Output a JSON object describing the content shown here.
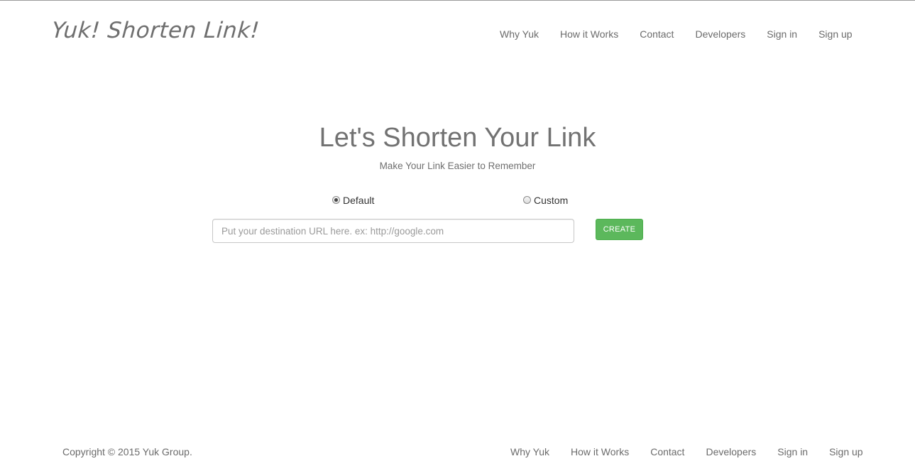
{
  "header": {
    "brand": "Yuk! Shorten Link!",
    "nav": [
      "Why Yuk",
      "How it Works",
      "Contact",
      "Developers",
      "Sign in",
      "Sign up"
    ]
  },
  "hero": {
    "title": "Let's Shorten Your Link",
    "subtitle": "Make Your Link Easier to Remember"
  },
  "form": {
    "options": [
      {
        "label": "Default",
        "selected": true
      },
      {
        "label": "Custom",
        "selected": false
      }
    ],
    "url_placeholder": "Put your destination URL here. ex: http://google.com",
    "url_value": "",
    "create_label": "CREATE"
  },
  "footer": {
    "copyright": "Copyright © 2015 Yuk Group.",
    "nav": [
      "Why Yuk",
      "How it Works",
      "Contact",
      "Developers",
      "Sign in",
      "Sign up"
    ]
  },
  "colors": {
    "accent_green": "#5cb85c",
    "text_gray": "#6b6b6b"
  }
}
